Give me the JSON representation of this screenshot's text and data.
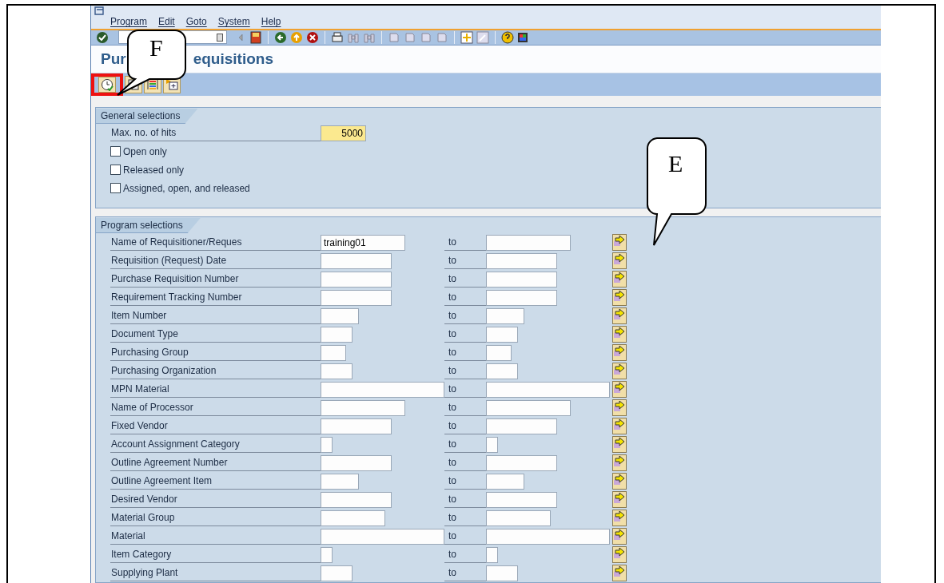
{
  "menu": [
    "Program",
    "Edit",
    "Goto",
    "System",
    "Help"
  ],
  "title_parts": [
    "Pur",
    "equisitions"
  ],
  "general_selections": {
    "title": "General selections",
    "max_hits": {
      "label": "Max. no. of hits",
      "value": "5000"
    },
    "options": [
      {
        "label": "Open only",
        "checked": false
      },
      {
        "label": "Released only",
        "checked": false
      },
      {
        "label": "Assigned, open, and released",
        "checked": false
      }
    ]
  },
  "program_selections": {
    "title": "Program selections",
    "rows": [
      {
        "label": "Name of Requisitioner/Reques",
        "kind": "name",
        "value": "training01",
        "to": "to"
      },
      {
        "label": "Requisition (Request) Date",
        "kind": "medium",
        "to": "to"
      },
      {
        "label": "Purchase Requisition Number",
        "kind": "medium",
        "to": "to"
      },
      {
        "label": "Requirement Tracking Number",
        "kind": "medium",
        "to": "to"
      },
      {
        "label": "Item Number",
        "kind": "item",
        "to": "to"
      },
      {
        "label": "Document Type",
        "kind": "code",
        "to": "to"
      },
      {
        "label": "Purchasing Group",
        "kind": "tiny",
        "to": "to"
      },
      {
        "label": "Purchasing Organization",
        "kind": "code",
        "to": "to"
      },
      {
        "label": "MPN Material",
        "kind": "wide",
        "to": "to"
      },
      {
        "label": "Name of Processor",
        "kind": "name",
        "to": "to"
      },
      {
        "label": "Fixed Vendor",
        "kind": "medium",
        "to": "to"
      },
      {
        "label": "Account Assignment Category",
        "kind": "flag",
        "to": "to"
      },
      {
        "label": "Outline Agreement Number",
        "kind": "medium",
        "to": "to"
      },
      {
        "label": "Outline Agreement Item",
        "kind": "item",
        "to": "to"
      },
      {
        "label": "Desired Vendor",
        "kind": "medium",
        "to": "to"
      },
      {
        "label": "Material Group",
        "kind": "group",
        "to": "to"
      },
      {
        "label": "Material",
        "kind": "wide",
        "to": "to"
      },
      {
        "label": "Item Category",
        "kind": "flag",
        "to": "to"
      },
      {
        "label": "Supplying Plant",
        "kind": "code",
        "to": "to"
      }
    ]
  },
  "callouts": [
    {
      "letter": "F"
    },
    {
      "letter": "E"
    }
  ]
}
